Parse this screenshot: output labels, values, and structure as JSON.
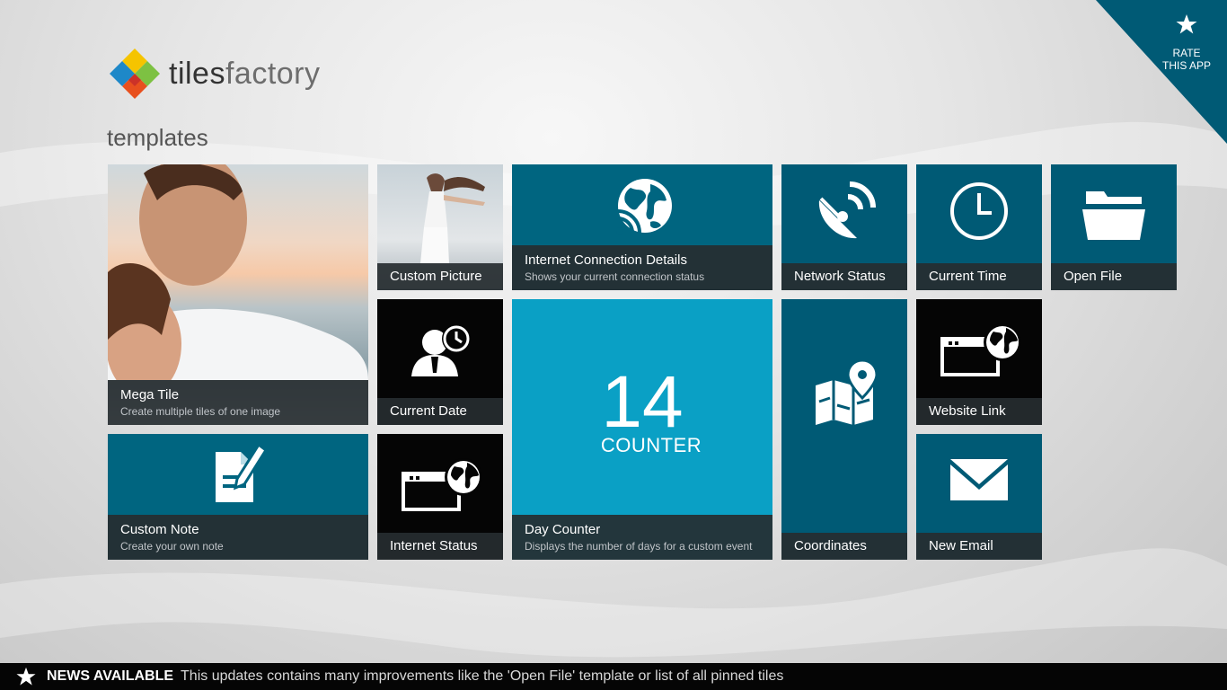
{
  "app": {
    "logo_part1": "tiles",
    "logo_part2": "factory",
    "section_title": "templates"
  },
  "rate": {
    "line1": "RATE",
    "line2": "THIS APP"
  },
  "tiles": {
    "mega_tile": {
      "title": "Mega Tile",
      "subtitle": "Create multiple tiles of one image"
    },
    "custom_picture": {
      "title": "Custom Picture"
    },
    "internet_connection": {
      "title": "Internet Connection Details",
      "subtitle": "Shows your current connection status"
    },
    "network_status": {
      "title": "Network Status"
    },
    "current_time": {
      "title": "Current Time"
    },
    "open_file": {
      "title": "Open File"
    },
    "current_date": {
      "title": "Current Date"
    },
    "day_counter": {
      "title": "Day Counter",
      "subtitle": "Displays the number of days for a custom event",
      "count": "14",
      "label": "COUNTER"
    },
    "coordinates": {
      "title": "Coordinates"
    },
    "website_link": {
      "title": "Website Link"
    },
    "custom_note": {
      "title": "Custom Note",
      "subtitle": "Create your own note"
    },
    "internet_status": {
      "title": "Internet Status"
    },
    "new_email": {
      "title": "New Email"
    }
  },
  "news": {
    "title": "NEWS AVAILABLE",
    "message": "This updates contains many improvements like the 'Open File' template or list of all pinned tiles"
  },
  "colors": {
    "tile_teal": "#006580",
    "tile_teal_deep": "#005a75",
    "tile_bright": "#0aa0c5",
    "tile_black": "#050505",
    "label_bar": "#262c30"
  }
}
